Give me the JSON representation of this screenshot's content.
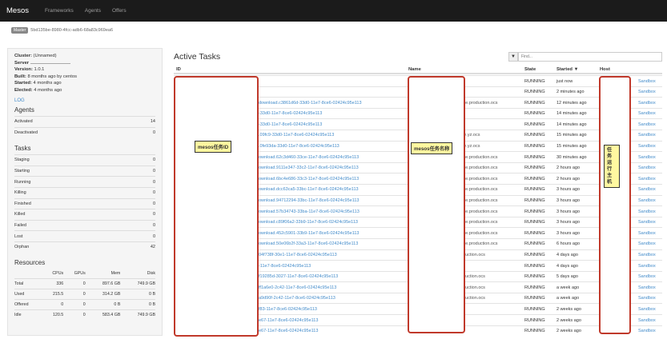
{
  "navbar": {
    "brand": "Mesos",
    "links": [
      "Frameworks",
      "Agents",
      "Offers"
    ]
  },
  "master": {
    "tag": "Master",
    "id": "5bd135be-8980-4fcc-adb6-68a83c969ea6"
  },
  "sidebar": {
    "info": [
      {
        "label": "Cluster:",
        "value": "(Unnamed)"
      },
      {
        "label": "Server",
        "value": ""
      },
      {
        "label": "Version:",
        "value": "1.0.1"
      },
      {
        "label": "Built:",
        "value": "8 months ago by centos"
      },
      {
        "label": "Started:",
        "value": "4 months ago"
      },
      {
        "label": "Elected:",
        "value": "4 months ago"
      }
    ],
    "log": "LOG",
    "agents_title": "Agents",
    "agents": [
      {
        "label": "Activated",
        "value": "14"
      },
      {
        "label": "Deactivated",
        "value": "0"
      }
    ],
    "tasks_title": "Tasks",
    "tasks": [
      {
        "label": "Staging",
        "value": "0"
      },
      {
        "label": "Starting",
        "value": "0"
      },
      {
        "label": "Running",
        "value": "0"
      },
      {
        "label": "Killing",
        "value": "0"
      },
      {
        "label": "Finished",
        "value": "0"
      },
      {
        "label": "Killed",
        "value": "0"
      },
      {
        "label": "Failed",
        "value": "0"
      },
      {
        "label": "Lost",
        "value": "0"
      },
      {
        "label": "Orphan",
        "value": "42"
      }
    ],
    "resources_title": "Resources",
    "resources_headers": [
      "",
      "CPUs",
      "GPUs",
      "Mem",
      "Disk"
    ],
    "resources": [
      [
        "Total",
        "336",
        "0",
        "897.6 GB",
        "749.9 GB"
      ],
      [
        "Used",
        "215.5",
        "0",
        "314.2 GB",
        "0 B"
      ],
      [
        "Offered",
        "0",
        "0",
        "0 B",
        "0 B"
      ],
      [
        "Idle",
        "120.5",
        "0",
        "583.4 GB",
        "749.9 GB"
      ]
    ]
  },
  "main": {
    "title": "Active Tasks",
    "filter_placeholder": "Find...",
    "headers": {
      "id": "ID",
      "name": "Name",
      "state": "State",
      "started": "Started ▼",
      "host": "Host"
    },
    "rows": [
      {
        "id": "",
        "name": "",
        "state": "RUNNING",
        "started": "just now",
        "sandbox": "Sandbox"
      },
      {
        "id": "",
        "name": "",
        "state": "RUNNING",
        "started": "2 minutes ago",
        "sandbox": "Sandbox"
      },
      {
        "id": "download.c3861d6d-33d0-11e7-8ce6-02424c95e113",
        "name": "age.production.ocs",
        "state": "RUNNING",
        "started": "12 minutes ago",
        "sandbox": "Sandbox"
      },
      {
        "id": "-33d0-11e7-8ce6-02424c95e113",
        "name": "",
        "state": "RUNNING",
        "started": "14 minutes ago",
        "sandbox": "Sandbox"
      },
      {
        "id": "-33d0-11e7-8ce6-02424c95e113",
        "name": "",
        "state": "RUNNING",
        "started": "14 minutes ago",
        "sandbox": "Sandbox"
      },
      {
        "id": ".09fc9-33d0-11e7-8ce6-02424c95e113",
        "name": "ige.yz.ocs",
        "state": "RUNNING",
        "started": "15 minutes ago",
        "sandbox": "Sandbox"
      },
      {
        "id": ".0fe93da-33d0-11e7-8ce6-02424c95e113",
        "name": "ige.yz.ocs",
        "state": "RUNNING",
        "started": "15 minutes ago",
        "sandbox": "Sandbox"
      },
      {
        "id": "ownload.62c3d460-33ce-11e7-8ce6-02424c95e113",
        "name": "age.production.ocs",
        "state": "RUNNING",
        "started": "30 minutes ago",
        "sandbox": "Sandbox"
      },
      {
        "id": "ownload.9111e347-33c2-11e7-8ce6-02424c95e113",
        "name": "age.production.ocs",
        "state": "RUNNING",
        "started": "2 hours ago",
        "sandbox": "Sandbox"
      },
      {
        "id": "ownload.6bc4e686-33c3-11e7-8ce6-02424c95e113",
        "name": "age.production.ocs",
        "state": "RUNNING",
        "started": "2 hours ago",
        "sandbox": "Sandbox"
      },
      {
        "id": "ownload.dcc63ca5-33bc-11e7-8ce6-02424c95e113",
        "name": "age.production.ocs",
        "state": "RUNNING",
        "started": "3 hours ago",
        "sandbox": "Sandbox"
      },
      {
        "id": "ownload.94712294-33bc-11e7-8ce6-02424c95e113",
        "name": "age.production.ocs",
        "state": "RUNNING",
        "started": "3 hours ago",
        "sandbox": "Sandbox"
      },
      {
        "id": "ownload.57b34743-33ba-11e7-8ce6-02424c95e113",
        "name": "age.production.ocs",
        "state": "RUNNING",
        "started": "3 hours ago",
        "sandbox": "Sandbox"
      },
      {
        "id": "ownload.c89f06a2-33b9-11e7-8ce6-02424c95e113",
        "name": "age.production.ocs",
        "state": "RUNNING",
        "started": "3 hours ago",
        "sandbox": "Sandbox"
      },
      {
        "id": "ownload.452c5901-33b9-11e7-8ce6-02424c95e113",
        "name": "age.production.ocs",
        "state": "RUNNING",
        "started": "3 hours ago",
        "sandbox": "Sandbox"
      },
      {
        "id": "ownload.50e06b2f-33a3-11e7-8ce6-02424c95e113",
        "name": "age.production.ocs",
        "state": "RUNNING",
        "started": "6 hours ago",
        "sandbox": "Sandbox"
      },
      {
        "id": "04f738f-30e1-11e7-8ce6-02424c95e113",
        "name": "oduction.ocs",
        "state": "RUNNING",
        "started": "4 days ago",
        "sandbox": "Sandbox"
      },
      {
        "id": "-11e7-8ce6-02424c95e113",
        "name": "",
        "state": "RUNNING",
        "started": "4 days ago",
        "sandbox": "Sandbox"
      },
      {
        "id": "f19285d-3027-11e7-8ce6-02424c95e113",
        "name": "oduction.ocs",
        "state": "RUNNING",
        "started": "5 days ago",
        "sandbox": "Sandbox"
      },
      {
        "id": "ff1a6e0-2c42-11e7-8ce6-02424c95e113",
        "name": "oduction.ocs",
        "state": "RUNNING",
        "started": "a week ago",
        "sandbox": "Sandbox"
      },
      {
        "id": "a9d90f-2c42-11e7-8ce6-02424c95e113",
        "name": "oduction.ocs",
        "state": "RUNNING",
        "started": "a week ago",
        "sandbox": "Sandbox"
      },
      {
        "id": "f83-11e7-8ce6-02424c95e113",
        "name": "",
        "state": "RUNNING",
        "started": "2 weeks ago",
        "sandbox": "Sandbox"
      },
      {
        "id": "e67-11e7-8ce6-02424c95e113",
        "name": "",
        "state": "RUNNING",
        "started": "2 weeks ago",
        "sandbox": "Sandbox"
      },
      {
        "id": "e67-11e7-8ce6-02424c95e113",
        "name": "",
        "state": "RUNNING",
        "started": "2 weeks ago",
        "sandbox": "Sandbox"
      }
    ]
  },
  "annotations": {
    "id_note": "mesos任务ID",
    "name_note": "mesos任务名称",
    "host_note": "任务运行主机"
  }
}
